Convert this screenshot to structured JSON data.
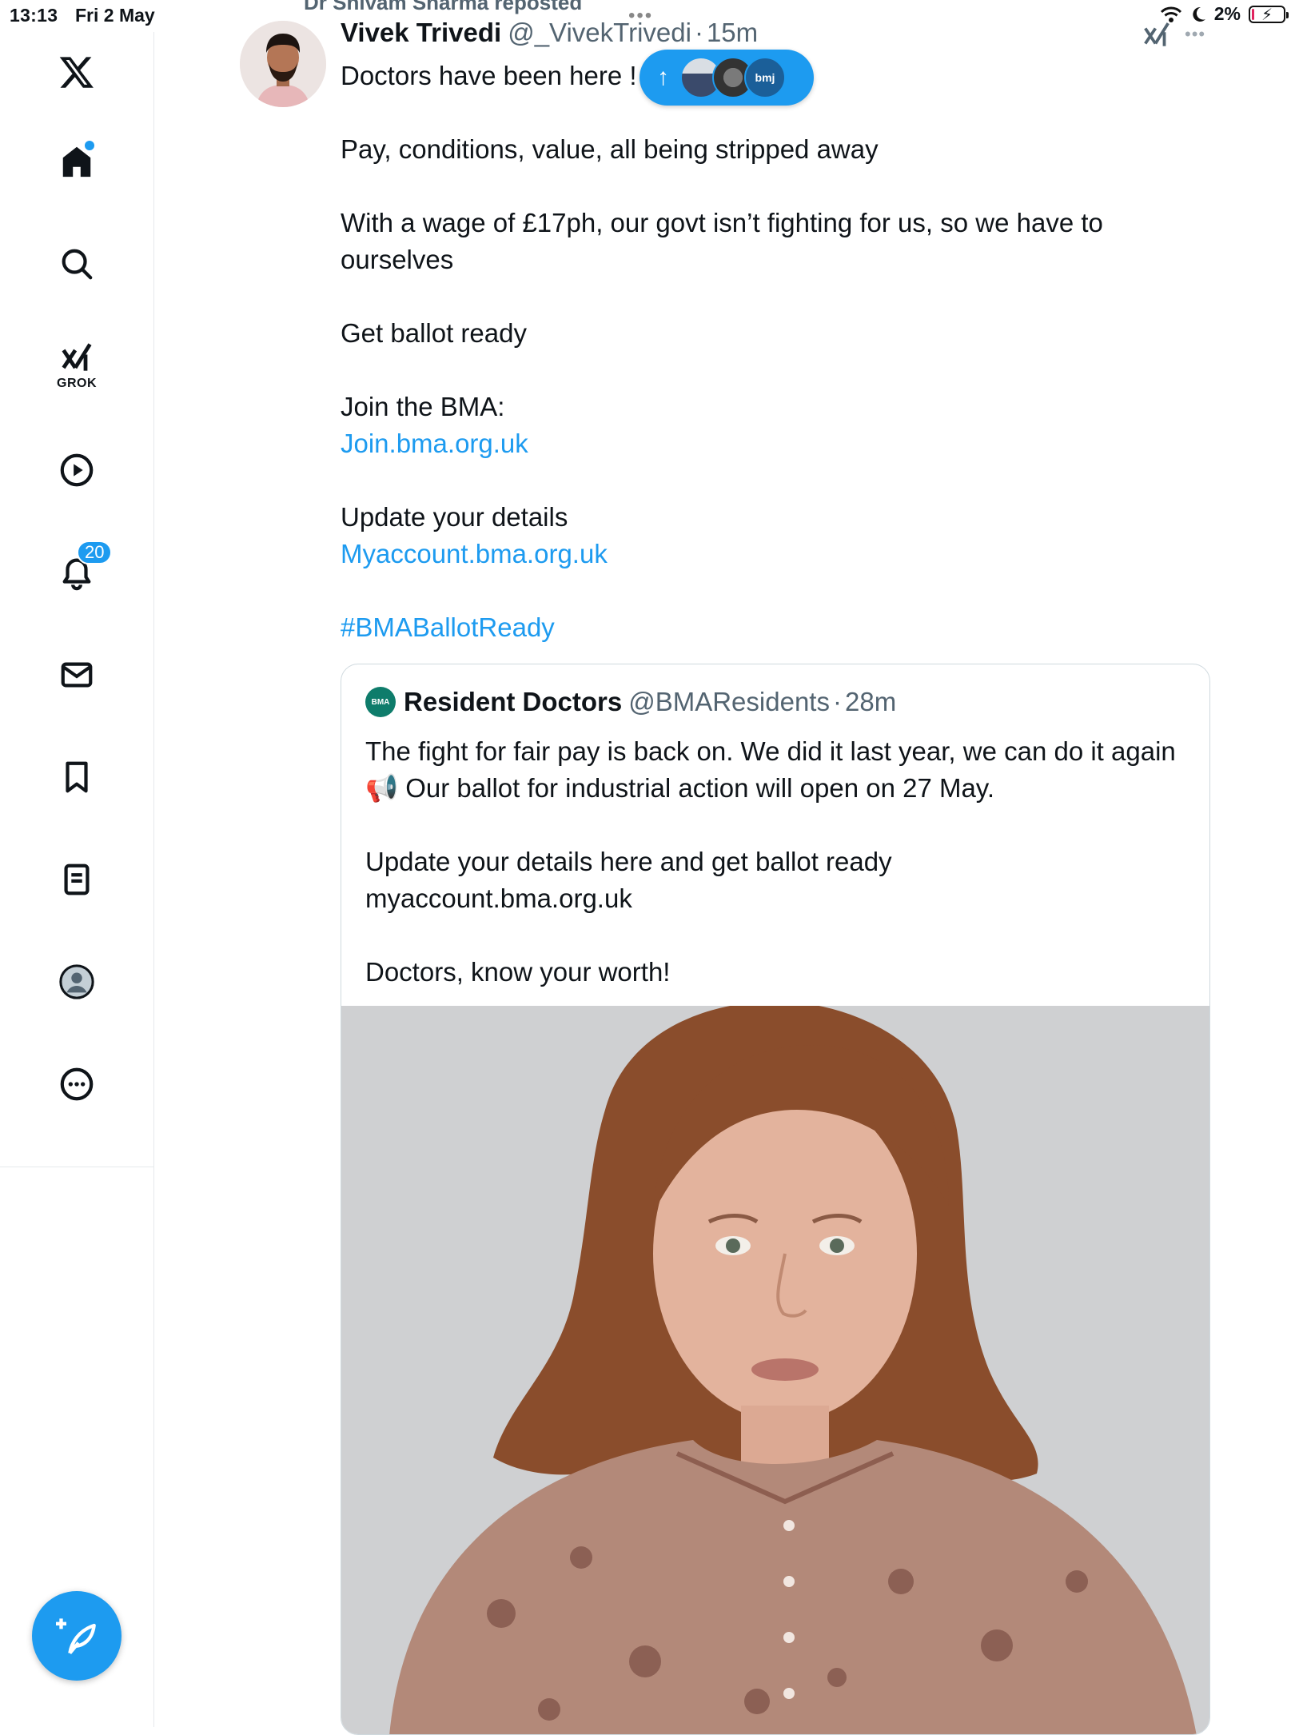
{
  "status_bar": {
    "time": "13:13",
    "date": "Fri 2 May",
    "battery": "2%"
  },
  "sidebar": {
    "items": [
      {
        "name": "home",
        "icon": "home-icon"
      },
      {
        "name": "search",
        "icon": "search-icon"
      },
      {
        "name": "grok",
        "icon": "grok-icon",
        "label": "GROK"
      },
      {
        "name": "video",
        "icon": "play-icon"
      },
      {
        "name": "notifications",
        "icon": "bell-icon",
        "badge": "20"
      },
      {
        "name": "messages",
        "icon": "mail-icon"
      },
      {
        "name": "bookmarks",
        "icon": "bookmark-icon"
      },
      {
        "name": "lists",
        "icon": "list-icon"
      },
      {
        "name": "profile",
        "icon": "avatar-icon"
      },
      {
        "name": "more",
        "icon": "more-icon"
      }
    ],
    "compose_icon": "compose-feather-icon"
  },
  "post": {
    "repost_text": "Dr Shivam Sharma reposted",
    "author_name": "Vivek Trivedi",
    "author_handle": "@_VivekTrivedi",
    "time": "15m",
    "lines": {
      "l1": "Doctors have been here !",
      "l2": "Pay, conditions, value, all being stripped away",
      "l3": "With a wage of £17ph, our govt isn’t fighting for us, so we have to ourselves",
      "l4": "Get ballot ready",
      "l5": "Join the BMA:",
      "link1": "Join.bma.org.uk",
      "l6": "Update your details",
      "link2": "Myaccount.bma.org.uk",
      "hashtag": "#BMABallotReady"
    }
  },
  "floating_pill": {
    "arrow": "↑",
    "label": "bmj"
  },
  "quote": {
    "logo_text": "BMA",
    "name": "Resident Doctors",
    "handle": "@BMAResidents",
    "time": "28m",
    "p1": "The fight for fair pay is back on. We did it last year, we can do it again 📢 Our ballot for industrial action will open on 27 May.",
    "p2a": "Update your details here and get ballot ready",
    "p2b": "myaccount.bma.org.uk",
    "p3": "Doctors, know your worth!"
  },
  "colors": {
    "accent": "#1d9bf0",
    "text": "#0f1419",
    "muted": "#536471"
  }
}
